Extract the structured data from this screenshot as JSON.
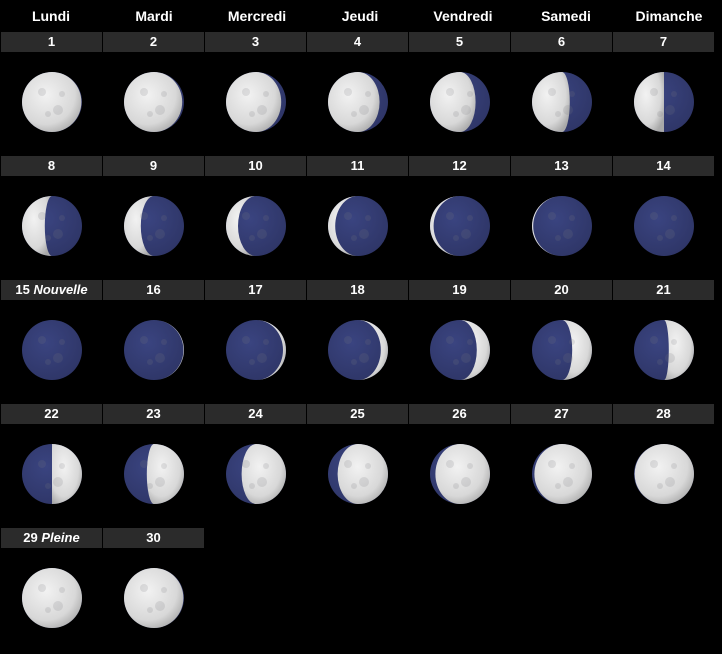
{
  "weekdays": [
    "Lundi",
    "Mardi",
    "Mercredi",
    "Jeudi",
    "Vendredi",
    "Samedi",
    "Dimanche"
  ],
  "colors": {
    "lit": "#d8d8d8",
    "dark": "#2e3566",
    "bar": "#2b2b2b",
    "background": "#000000"
  },
  "days": [
    {
      "day": "1",
      "phase_name": "",
      "illumination": 0.99,
      "waxing": false
    },
    {
      "day": "2",
      "phase_name": "",
      "illumination": 0.97,
      "waxing": false
    },
    {
      "day": "3",
      "phase_name": "",
      "illumination": 0.92,
      "waxing": false
    },
    {
      "day": "4",
      "phase_name": "",
      "illumination": 0.86,
      "waxing": false
    },
    {
      "day": "5",
      "phase_name": "",
      "illumination": 0.76,
      "waxing": false
    },
    {
      "day": "6",
      "phase_name": "",
      "illumination": 0.63,
      "waxing": false
    },
    {
      "day": "7",
      "phase_name": "",
      "illumination": 0.5,
      "waxing": false
    },
    {
      "day": "8",
      "phase_name": "",
      "illumination": 0.38,
      "waxing": false
    },
    {
      "day": "9",
      "phase_name": "",
      "illumination": 0.28,
      "waxing": false
    },
    {
      "day": "10",
      "phase_name": "",
      "illumination": 0.2,
      "waxing": false
    },
    {
      "day": "11",
      "phase_name": "",
      "illumination": 0.12,
      "waxing": false
    },
    {
      "day": "12",
      "phase_name": "",
      "illumination": 0.06,
      "waxing": false
    },
    {
      "day": "13",
      "phase_name": "",
      "illumination": 0.02,
      "waxing": false
    },
    {
      "day": "14",
      "phase_name": "",
      "illumination": 0.0,
      "waxing": false
    },
    {
      "day": "15",
      "phase_name": "Nouvelle",
      "illumination": 0.0,
      "waxing": true
    },
    {
      "day": "16",
      "phase_name": "",
      "illumination": 0.01,
      "waxing": true
    },
    {
      "day": "17",
      "phase_name": "",
      "illumination": 0.05,
      "waxing": true
    },
    {
      "day": "18",
      "phase_name": "",
      "illumination": 0.12,
      "waxing": true
    },
    {
      "day": "19",
      "phase_name": "",
      "illumination": 0.22,
      "waxing": true
    },
    {
      "day": "20",
      "phase_name": "",
      "illumination": 0.33,
      "waxing": true
    },
    {
      "day": "21",
      "phase_name": "",
      "illumination": 0.42,
      "waxing": true
    },
    {
      "day": "22",
      "phase_name": "",
      "illumination": 0.5,
      "waxing": true
    },
    {
      "day": "23",
      "phase_name": "",
      "illumination": 0.62,
      "waxing": true
    },
    {
      "day": "24",
      "phase_name": "",
      "illumination": 0.74,
      "waxing": true
    },
    {
      "day": "25",
      "phase_name": "",
      "illumination": 0.84,
      "waxing": true
    },
    {
      "day": "26",
      "phase_name": "",
      "illumination": 0.91,
      "waxing": true
    },
    {
      "day": "27",
      "phase_name": "",
      "illumination": 0.96,
      "waxing": true
    },
    {
      "day": "28",
      "phase_name": "",
      "illumination": 0.99,
      "waxing": true
    },
    {
      "day": "29",
      "phase_name": "Pleine",
      "illumination": 1.0,
      "waxing": true
    },
    {
      "day": "30",
      "phase_name": "",
      "illumination": 0.99,
      "waxing": false
    }
  ]
}
